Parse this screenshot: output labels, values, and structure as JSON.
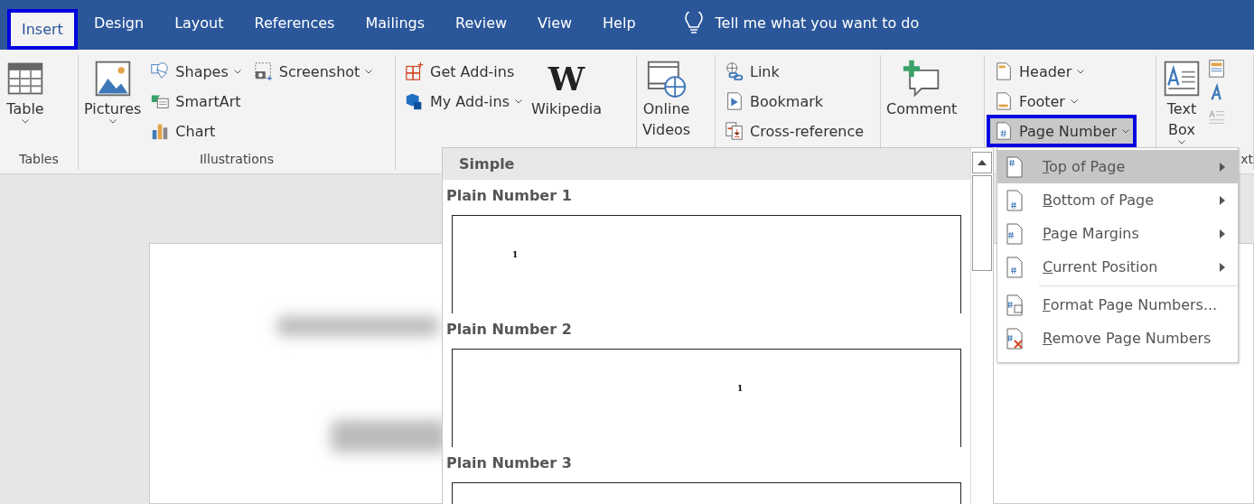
{
  "tabs": [
    {
      "label": "Insert",
      "selected": true,
      "annotated": true
    },
    {
      "label": "Design",
      "selected": false,
      "annotated": false
    },
    {
      "label": "Layout",
      "selected": false,
      "annotated": false
    },
    {
      "label": "References",
      "selected": false,
      "annotated": false
    },
    {
      "label": "Mailings",
      "selected": false,
      "annotated": false
    },
    {
      "label": "Review",
      "selected": false,
      "annotated": false
    },
    {
      "label": "View",
      "selected": false,
      "annotated": false
    },
    {
      "label": "Help",
      "selected": false,
      "annotated": false
    }
  ],
  "search": {
    "placeholder": "Tell me what you want to do"
  },
  "ribbon_groups": [
    {
      "label": "Tables",
      "items": [
        {
          "kind": "large",
          "label": "Table",
          "dropdown": true
        }
      ]
    },
    {
      "label": "Illustrations",
      "items": [
        {
          "kind": "large",
          "label": "Pictures",
          "dropdown": true
        },
        {
          "kind": "stack",
          "items": [
            {
              "label": "Shapes",
              "dropdown": true
            },
            {
              "label": "SmartArt",
              "dropdown": false
            },
            {
              "label": "Chart",
              "dropdown": false
            }
          ]
        },
        {
          "kind": "stack",
          "items": [
            {
              "label": "Screenshot",
              "dropdown": true
            }
          ]
        }
      ]
    },
    {
      "items": [
        {
          "kind": "stack",
          "items": [
            {
              "label": "Get Add-ins",
              "dropdown": false
            },
            {
              "label": "My Add-ins",
              "dropdown": true
            }
          ]
        },
        {
          "kind": "logo",
          "logo_text": "W",
          "label": "Wikipedia"
        }
      ]
    },
    {
      "items": [
        {
          "kind": "large",
          "label": "Online Videos",
          "dropdown": false
        }
      ]
    },
    {
      "items": [
        {
          "kind": "stack",
          "items": [
            {
              "label": "Link",
              "dropdown": false
            },
            {
              "label": "Bookmark",
              "dropdown": false
            },
            {
              "label": "Cross-reference",
              "dropdown": false
            }
          ]
        }
      ]
    },
    {
      "items": [
        {
          "kind": "large",
          "label": "Comment",
          "dropdown": false
        }
      ]
    },
    {
      "items": [
        {
          "kind": "stack",
          "items": [
            {
              "label": "Header",
              "dropdown": true,
              "expanded": false,
              "annotated": false
            },
            {
              "label": "Footer",
              "dropdown": true,
              "expanded": false,
              "annotated": false
            },
            {
              "label": "Page Number",
              "dropdown": true,
              "expanded": true,
              "annotated": true
            }
          ]
        }
      ]
    },
    {
      "label": "xt",
      "items": [
        {
          "kind": "large",
          "label": "Text Box",
          "dropdown": true
        },
        {
          "kind": "mini"
        }
      ]
    }
  ],
  "gallery": {
    "section": "Simple",
    "items": [
      {
        "title": "Plain Number 1",
        "number": "1"
      },
      {
        "title": "Plain Number 2",
        "number": "1"
      },
      {
        "title": "Plain Number 3"
      }
    ]
  },
  "submenu": [
    {
      "label": "Top of Page",
      "selected": true,
      "submenu": true
    },
    {
      "label": "Bottom of Page",
      "selected": false,
      "submenu": true
    },
    {
      "label": "Page Margins",
      "selected": false,
      "submenu": true
    },
    {
      "label": "Current Position",
      "selected": false,
      "submenu": true
    },
    {
      "label": "Format Page Numbers...",
      "selected": false,
      "submenu": false,
      "divider_before": true
    },
    {
      "label": "Remove Page Numbers",
      "selected": false,
      "submenu": false
    }
  ]
}
